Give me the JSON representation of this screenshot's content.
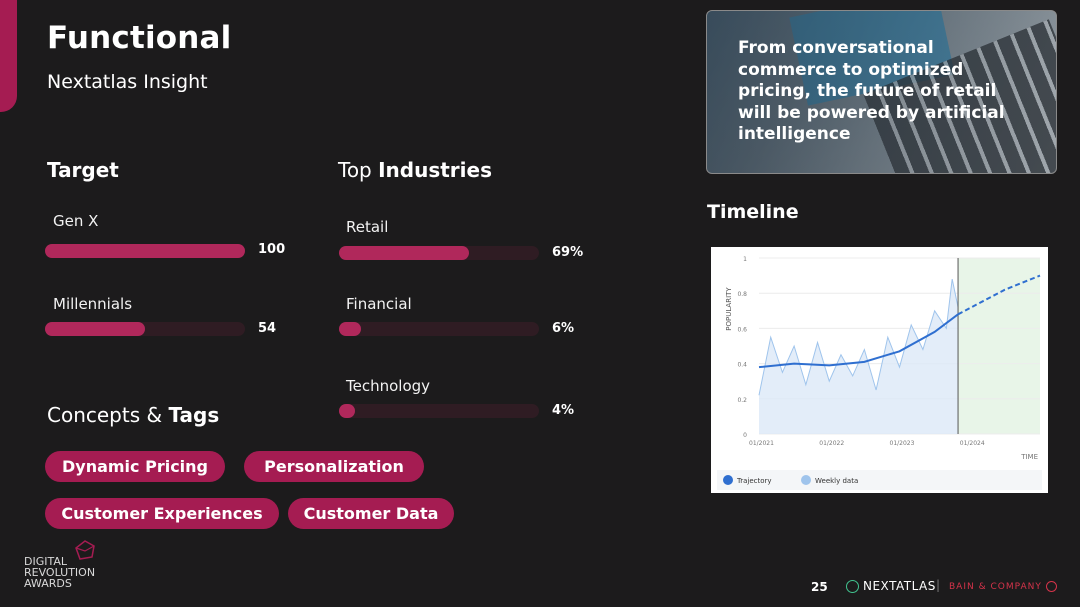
{
  "header": {
    "title": "Functional",
    "subtitle": "Nextatlas Insight"
  },
  "target": {
    "title": "Target",
    "items": [
      {
        "label": "Gen X",
        "value": "100",
        "fill": 1.0
      },
      {
        "label": "Millennials",
        "value": "54",
        "fill": 0.5
      }
    ]
  },
  "industries": {
    "title_prefix": "Top",
    "title_bold": "Industries",
    "items": [
      {
        "label": "Retail",
        "value": "69%",
        "fill": 0.65
      },
      {
        "label": "Financial",
        "value": "6%",
        "fill": 0.11
      },
      {
        "label": "Technology",
        "value": "4%",
        "fill": 0.08
      }
    ]
  },
  "concepts": {
    "title_prefix": "Concepts &",
    "title_bold": "Tags",
    "tags": [
      "Dynamic Pricing",
      "Personalization",
      "Customer Experiences",
      "Customer Data"
    ]
  },
  "hero": {
    "text": "From conversational commerce to optimized pricing, the future of retail will be powered by artificial intelligence"
  },
  "timeline": {
    "title": "Timeline",
    "ylabel": "POPULARITY",
    "xlabel": "TIME",
    "yticks": [
      "1",
      "0.8",
      "0.6",
      "0.4",
      "0.2",
      "0"
    ],
    "xticks": [
      "01/2021",
      "01/2022",
      "01/2023",
      "01/2024"
    ],
    "legend": [
      "Trajectory",
      "Weekly data"
    ],
    "colors": {
      "trajectory": "#2f6fd0",
      "weekly": "#9fc4ec",
      "forecast_bg": "#e8f5e8"
    }
  },
  "chart_data": {
    "type": "line",
    "ylim": [
      0,
      1
    ],
    "series": [
      {
        "name": "Trajectory",
        "x": [
          "01/2021",
          "07/2021",
          "01/2022",
          "07/2022",
          "01/2023",
          "07/2023",
          "11/2023"
        ],
        "values": [
          0.38,
          0.4,
          0.39,
          0.41,
          0.47,
          0.58,
          0.68
        ]
      },
      {
        "name": "Trajectory (forecast)",
        "x": [
          "11/2023",
          "07/2024",
          "01/2025"
        ],
        "values": [
          0.68,
          0.82,
          0.9
        ]
      },
      {
        "name": "Weekly data",
        "x": [
          "01/2021",
          "03/2021",
          "05/2021",
          "07/2021",
          "09/2021",
          "11/2021",
          "01/2022",
          "03/2022",
          "05/2022",
          "07/2022",
          "09/2022",
          "11/2022",
          "01/2023",
          "03/2023",
          "05/2023",
          "07/2023",
          "09/2023",
          "10/2023",
          "11/2023"
        ],
        "values": [
          0.22,
          0.55,
          0.35,
          0.5,
          0.28,
          0.52,
          0.3,
          0.45,
          0.33,
          0.48,
          0.25,
          0.55,
          0.38,
          0.62,
          0.48,
          0.7,
          0.6,
          0.88,
          0.72
        ]
      }
    ]
  },
  "footer": {
    "page": "25",
    "brand": "NEXTATLAS",
    "partner": "BAIN & COMPANY"
  },
  "award": {
    "lines": [
      "DIGITAL",
      "REVOLUTION",
      "AWARDS"
    ]
  }
}
